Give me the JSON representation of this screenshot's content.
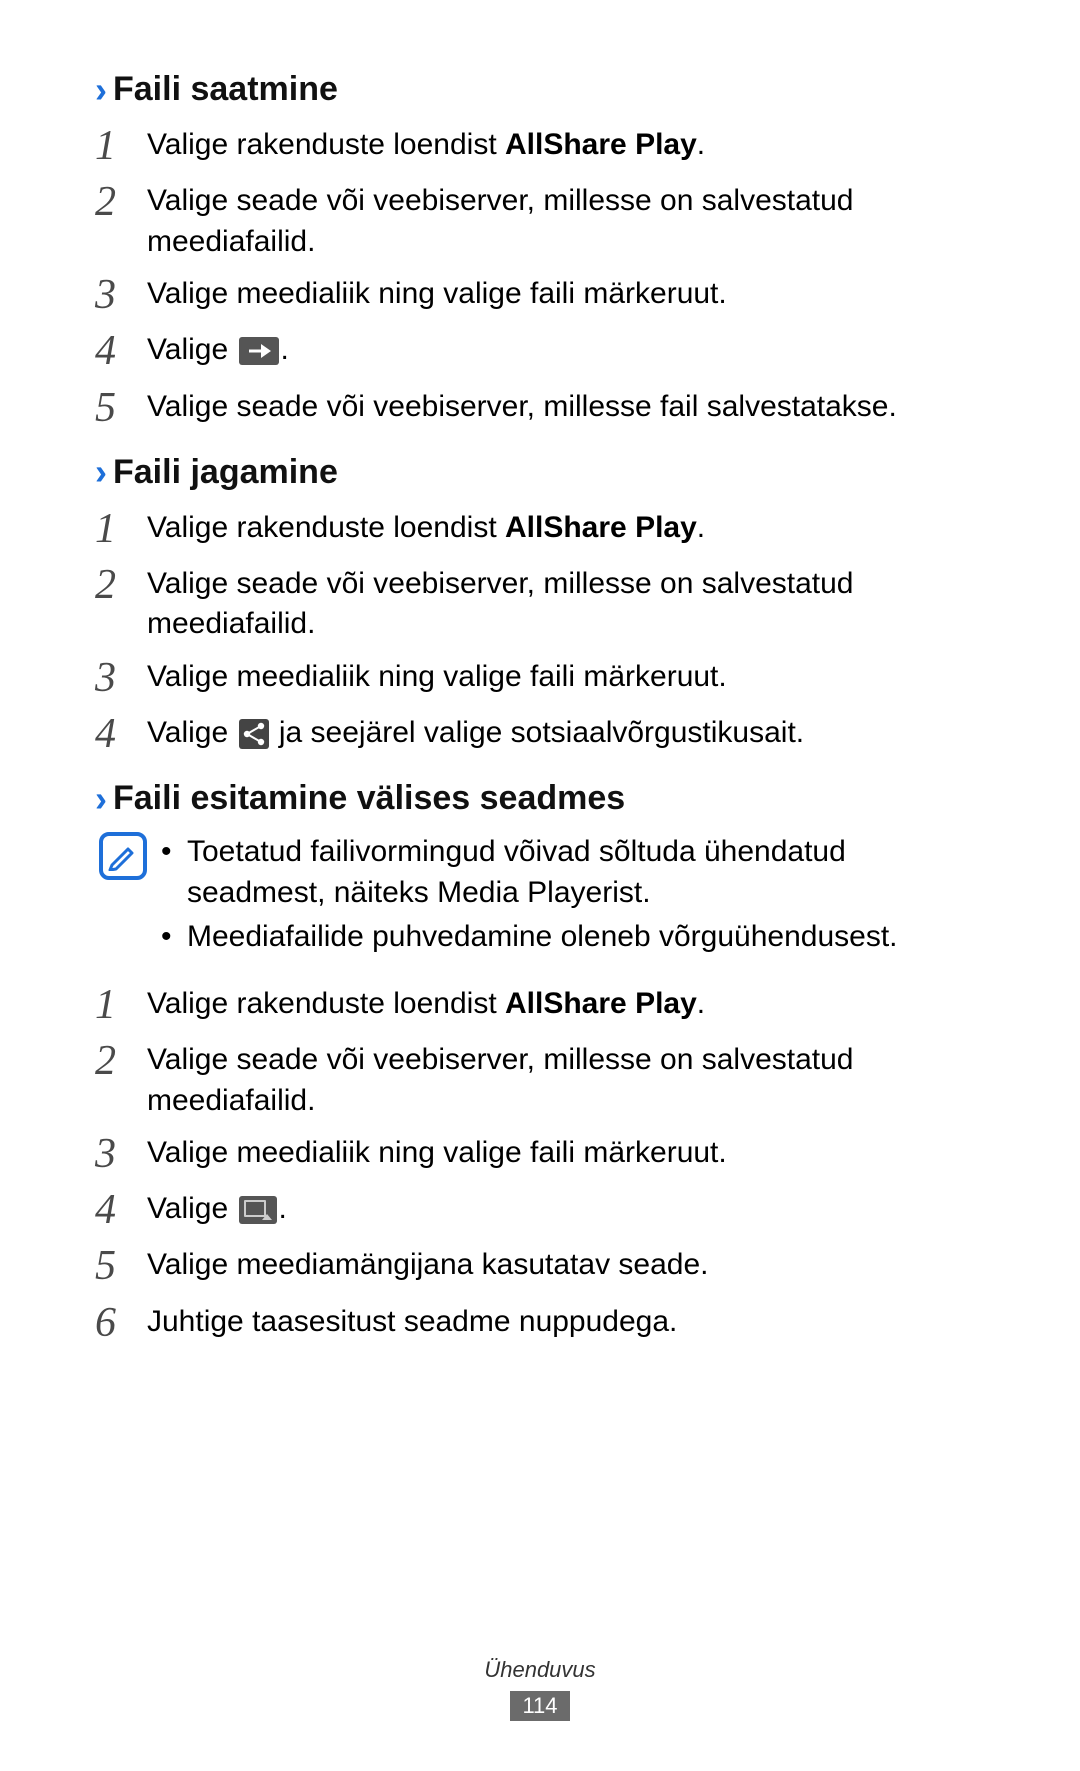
{
  "sections": [
    {
      "heading": "Faili saatmine",
      "steps": [
        {
          "n": "1",
          "pre": "Valige rakenduste loendist ",
          "bold": "AllShare Play",
          "post": "."
        },
        {
          "n": "2",
          "text": "Valige seade või veebiserver, millesse on salvestatud meediafailid."
        },
        {
          "n": "3",
          "text": "Valige meedialiik ning valige faili märkeruut."
        },
        {
          "n": "4",
          "pre": "Valige ",
          "icon": "forward",
          "post": "."
        },
        {
          "n": "5",
          "text": "Valige seade või veebiserver, millesse fail salvestatakse."
        }
      ]
    },
    {
      "heading": "Faili jagamine",
      "steps": [
        {
          "n": "1",
          "pre": "Valige rakenduste loendist ",
          "bold": "AllShare Play",
          "post": "."
        },
        {
          "n": "2",
          "text": "Valige seade või veebiserver, millesse on salvestatud meediafailid."
        },
        {
          "n": "3",
          "text": "Valige meedialiik ning valige faili märkeruut."
        },
        {
          "n": "4",
          "pre": "Valige ",
          "icon": "share",
          "post": " ja seejärel valige sotsiaalvõrgustikusait."
        }
      ]
    },
    {
      "heading": "Faili esitamine välises seadmes",
      "note": [
        "Toetatud failivormingud võivad sõltuda ühendatud seadmest, näiteks Media Playerist.",
        "Meediafailide puhvedamine oleneb võrguühendusest."
      ],
      "steps": [
        {
          "n": "1",
          "pre": "Valige rakenduste loendist ",
          "bold": "AllShare Play",
          "post": "."
        },
        {
          "n": "2",
          "text": "Valige seade või veebiserver, millesse on salvestatud meediafailid."
        },
        {
          "n": "3",
          "text": "Valige meedialiik ning valige faili märkeruut."
        },
        {
          "n": "4",
          "pre": "Valige ",
          "icon": "cast",
          "post": "."
        },
        {
          "n": "5",
          "text": "Valige meediamängijana kasutatav seade."
        },
        {
          "n": "6",
          "text": "Juhtige taasesitust seadme nuppudega."
        }
      ]
    }
  ],
  "footer": {
    "category": "Ühenduvus",
    "page": "114"
  }
}
